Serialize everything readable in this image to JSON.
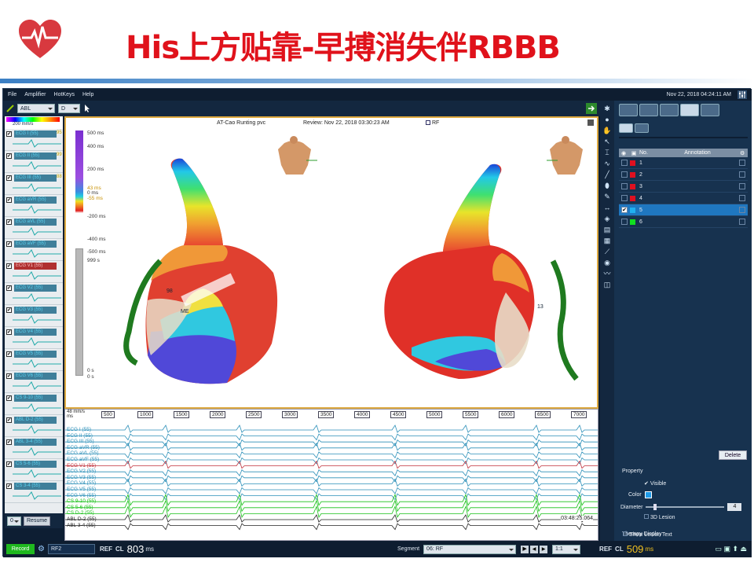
{
  "slide": {
    "title": "His上方贴靠-早搏消失伴RBBB"
  },
  "menu": {
    "items": [
      "File",
      "Amplifier",
      "HotKeys",
      "Help"
    ],
    "datetime": "Nov 22, 2018 04:24:11 AM"
  },
  "toolbar": {
    "combo1": "ABL",
    "combo2": "D"
  },
  "left_panel": {
    "speed": "200 mm/s",
    "channels": [
      {
        "name": "ECG I (55)",
        "val": "95",
        "red": false
      },
      {
        "name": "ECG II (55)",
        "val": "99",
        "red": false
      },
      {
        "name": "ECG III (55)",
        "val": "88",
        "red": false
      },
      {
        "name": "ECG aVR (55)",
        "val": "",
        "red": false
      },
      {
        "name": "ECG aVL (55)",
        "val": "",
        "red": false
      },
      {
        "name": "ECG aVF (55)",
        "val": "",
        "red": false
      },
      {
        "name": "ECG V1 (55)",
        "val": "",
        "red": true
      },
      {
        "name": "ECG V2 (55)",
        "val": "",
        "red": false
      },
      {
        "name": "ECG V3 (55)",
        "val": "",
        "red": false
      },
      {
        "name": "ECG V4 (55)",
        "val": "",
        "red": false
      },
      {
        "name": "ECG V5 (55)",
        "val": "",
        "red": false
      },
      {
        "name": "ECG V6 (55)",
        "val": "",
        "red": false
      },
      {
        "name": "CS 9-10 (55)",
        "val": "",
        "red": false
      },
      {
        "name": "ABL D-2 (55)",
        "val": "",
        "red": false
      },
      {
        "name": "ABL 3-4 (55)",
        "val": "",
        "red": false
      },
      {
        "name": "CS 5-6 (55)",
        "val": "",
        "red": false
      },
      {
        "name": "CS 3-4 (55)",
        "val": "",
        "red": false
      }
    ],
    "measure": "33 ms",
    "bottom_combo": "0",
    "resume": "Resume"
  },
  "map": {
    "header_title": "AT-Cao Runting pvc",
    "review": "Review: Nov 22, 2018 03:30:23 AM",
    "rf": "RF",
    "scale_labels": [
      "500 ms",
      "400 ms",
      "200 ms",
      "43 ms",
      "0 ms",
      "-55 ms",
      "-200 ms",
      "-400 ms",
      "-500 ms",
      "999 s",
      "0 s",
      "0 s"
    ],
    "left_electrode_labels": [
      "98",
      "ME"
    ],
    "right_electrode_label": "13"
  },
  "ecg": {
    "speed_top": "48 mm/s",
    "speed_unit": "ms",
    "ticks": [
      "500",
      "1000",
      "1500",
      "2000",
      "2500",
      "3000",
      "3500",
      "4000",
      "4500",
      "5000",
      "5500",
      "6000",
      "6500",
      "7000"
    ],
    "labels": [
      "ECG I (55)",
      "ECG II (55)",
      "ECG III (55)",
      "ECG aVR (55)",
      "ECG aVL (55)",
      "ECG aVF (55)",
      "ECG V1 (55)",
      "ECG V2 (55)",
      "ECG V3 (55)",
      "ECG V4 (55)",
      "ECG V5 (55)",
      "ECG V6 (55)",
      "CS 9-10 (55)",
      "CS 5-6 (55)",
      "CS D-2 (55)",
      "ABL D-2 (55)",
      "ABL 3-4 (55)"
    ],
    "timestamp": "03:48:25.064",
    "segment_label": "Segment",
    "segment_value": "06: RF",
    "zoom": "1:1"
  },
  "status": {
    "record": "Record",
    "ref_field": "RF2",
    "ref_label": "REF",
    "cl_label": "CL",
    "cl_value": "803",
    "cl_unit": "ms",
    "ref2_label": "REF",
    "cl2_label": "CL",
    "cl2_value": "509",
    "cl2_unit": "ms"
  },
  "right_panel": {
    "columns": [
      "No.",
      "Annotation"
    ],
    "rows": [
      {
        "no": "1",
        "color": "#e01020",
        "checked": false,
        "selected": false
      },
      {
        "no": "2",
        "color": "#e01020",
        "checked": false,
        "selected": false
      },
      {
        "no": "3",
        "color": "#e01020",
        "checked": false,
        "selected": false
      },
      {
        "no": "4",
        "color": "#e01020",
        "checked": false,
        "selected": false
      },
      {
        "no": "5",
        "color": "#20b0f0",
        "checked": true,
        "selected": true
      },
      {
        "no": "6",
        "color": "#10e020",
        "checked": false,
        "selected": false
      }
    ],
    "delete": "Delete",
    "property": "Property",
    "visible": "Visible",
    "color": "Color",
    "diameter": "Diameter",
    "diameter_value": "4",
    "lesion3d": "3D Lesion",
    "therapy": "Therapy Display",
    "show_lesion_text": "Show Lesion Text",
    "accent": "#1f9be8"
  }
}
